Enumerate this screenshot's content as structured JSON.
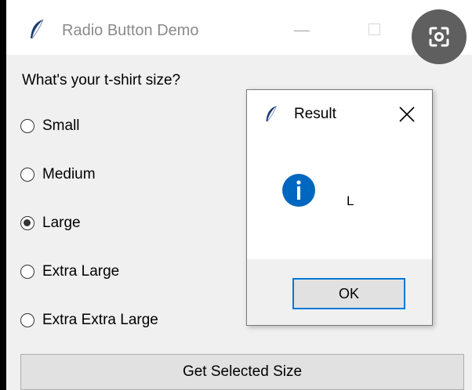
{
  "window": {
    "title": "Radio Button Demo",
    "question": "What's your t-shirt size?",
    "options": [
      {
        "label": "Small",
        "checked": false
      },
      {
        "label": "Medium",
        "checked": false
      },
      {
        "label": "Large",
        "checked": true
      },
      {
        "label": "Extra Large",
        "checked": false
      },
      {
        "label": "Extra Extra Large",
        "checked": false
      }
    ],
    "button_label": "Get Selected Size",
    "icons": {
      "app": "feather-icon",
      "overlay": "screenshot-lens-icon"
    }
  },
  "dialog": {
    "title": "Result",
    "message": "L",
    "ok_label": "OK",
    "icons": {
      "app": "feather-icon",
      "info": "info-icon",
      "close": "close-icon"
    }
  },
  "colors": {
    "window_bg": "#f0f0f0",
    "titlebar_bg": "#ffffff",
    "info_blue": "#0067c0",
    "focus_border": "#0078d7"
  }
}
